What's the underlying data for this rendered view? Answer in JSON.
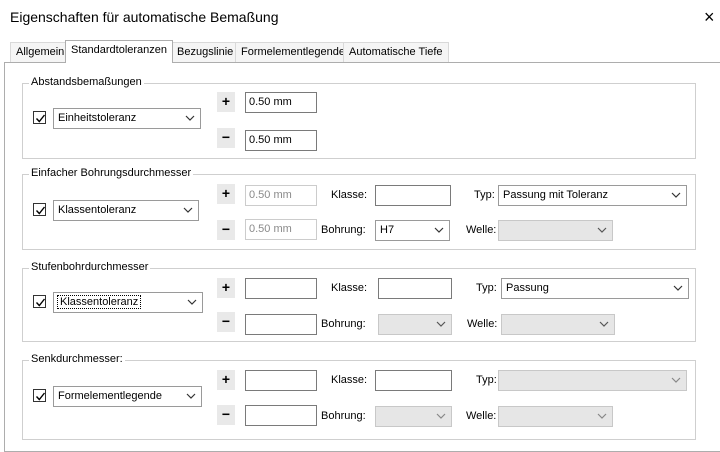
{
  "window": {
    "title": "Eigenschaften für automatische Bemaßung",
    "close_glyph": "×"
  },
  "tabs": [
    {
      "label": "Allgemein"
    },
    {
      "label": "Standardtoleranzen"
    },
    {
      "label": "Bezugslinie"
    },
    {
      "label": "Formelementlegende"
    },
    {
      "label": "Automatische Tiefe"
    }
  ],
  "active_tab": "Standardtoleranzen",
  "buttons": {
    "plus": "+",
    "minus": "−"
  },
  "abstand": {
    "title": "Abstandsbemaßungen",
    "checked": true,
    "combo": "Einheitstoleranz",
    "plus_value": "0.50 mm",
    "minus_value": "0.50 mm"
  },
  "einfach": {
    "title": "Einfacher Bohrungsdurchmesser",
    "checked": true,
    "combo": "Klassentoleranz",
    "plus_value": "0.50 mm",
    "minus_value": "0.50 mm",
    "klasse_label": "Klasse:",
    "klasse_value": "",
    "bohrung_label": "Bohrung:",
    "bohrung_value": "H7",
    "typ_label": "Typ:",
    "typ_value": "Passung mit Toleranz",
    "welle_label": "Welle:",
    "welle_value": ""
  },
  "stufen": {
    "title": "Stufenbohrdurchmesser",
    "checked": true,
    "combo": "Klassentoleranz",
    "plus_value": "",
    "minus_value": "",
    "klasse_label": "Klasse:",
    "klasse_value": "",
    "bohrung_label": "Bohrung:",
    "bohrung_value": "",
    "typ_label": "Typ:",
    "typ_value": "Passung",
    "welle_label": "Welle:",
    "welle_value": ""
  },
  "senk": {
    "title": "Senkdurchmesser:",
    "checked": true,
    "combo": "Formelementlegende",
    "plus_value": "",
    "minus_value": "",
    "klasse_label": "Klasse:",
    "klasse_value": "",
    "bohrung_label": "Bohrung:",
    "bohrung_value": "",
    "typ_label": "Typ:",
    "typ_value": "",
    "welle_label": "Welle:",
    "welle_value": ""
  }
}
